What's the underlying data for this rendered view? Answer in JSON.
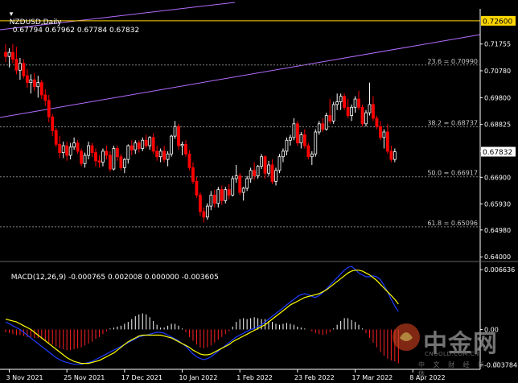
{
  "header": {
    "symbol": "NZDUSD,Daily",
    "ohlc": "0.67794 0.67962 0.67784 0.67832",
    "macd": "MACD(12,26,9) -0.000765 0.002008 0.000000 -0.003605"
  },
  "watermark": {
    "brand_cn": "中金网",
    "brand_en": "CNGOLD.COM.CN",
    "tagline": "中 文 财 经 新 媒 体"
  },
  "colors": {
    "background": "#000000",
    "axis": "#ffffff",
    "bull_candle": "#ffffff",
    "bear_candle": "#ff0000",
    "fib_lines": "#808080",
    "channel_line": "#b56cff",
    "resistance_line": "#ffd700",
    "macd_hist_pos": "#ffffff",
    "macd_hist_neg": "#ff2020",
    "macd_line": "#1e3cff",
    "signal_line": "#ffff00"
  },
  "chart_data": [
    {
      "type": "candlestick",
      "symbol": "NZDUSD",
      "timeframe": "Daily",
      "y_ticks": [
        0.71755,
        0.7078,
        0.698,
        0.68825,
        0.6785,
        0.669,
        0.6593,
        0.6498,
        0.64
      ],
      "y_tick_labels": [
        "0.71755",
        "0.70780",
        "0.69800",
        "0.68825",
        "0.67850",
        "0.66900",
        "0.65930",
        "0.64980",
        "0.64000"
      ],
      "ylim": [
        0.6389,
        0.7286
      ],
      "current_price": 0.67832,
      "current_price_label": "0.67832",
      "resistance": {
        "value": 0.726,
        "label": "0.72600"
      },
      "fib_levels": [
        {
          "label": "23.6 = 0.70990",
          "value": 0.7099
        },
        {
          "label": "38.2 = 0.68737",
          "value": 0.68737
        },
        {
          "label": "50.0 = 0.66917",
          "value": 0.66917
        },
        {
          "label": "61.8 = 0.65096",
          "value": 0.65096
        }
      ],
      "x_labels": [
        {
          "label": "3 Nov 2021",
          "index": 1
        },
        {
          "label": "25 Nov 2021",
          "index": 17
        },
        {
          "label": "17 Dec 2021",
          "index": 33
        },
        {
          "label": "10 Jan 2022",
          "index": 49
        },
        {
          "label": "1 Feb 2022",
          "index": 65
        },
        {
          "label": "23 Feb 2022",
          "index": 81
        },
        {
          "label": "17 Mar 2022",
          "index": 97
        },
        {
          "label": "8 Apr 2022",
          "index": 113
        }
      ],
      "ohlc": [
        [
          0.7145,
          0.7175,
          0.711,
          0.713
        ],
        [
          0.713,
          0.716,
          0.709,
          0.7145
        ],
        [
          0.7145,
          0.7175,
          0.7105,
          0.712
        ],
        [
          0.712,
          0.7165,
          0.7065,
          0.708
        ],
        [
          0.708,
          0.7125,
          0.7045,
          0.7105
        ],
        [
          0.7105,
          0.712,
          0.705,
          0.706
        ],
        [
          0.706,
          0.7085,
          0.7015,
          0.7035
        ],
        [
          0.7035,
          0.7065,
          0.6995,
          0.7045
        ],
        [
          0.7045,
          0.707,
          0.7005,
          0.702
        ],
        [
          0.702,
          0.706,
          0.698,
          0.7035
        ],
        [
          0.7035,
          0.7045,
          0.6975,
          0.699
        ],
        [
          0.699,
          0.701,
          0.695,
          0.697
        ],
        [
          0.697,
          0.699,
          0.689,
          0.691
        ],
        [
          0.691,
          0.692,
          0.684,
          0.686
        ],
        [
          0.686,
          0.687,
          0.68,
          0.681
        ],
        [
          0.681,
          0.684,
          0.676,
          0.678
        ],
        [
          0.678,
          0.682,
          0.676,
          0.6805
        ],
        [
          0.6805,
          0.682,
          0.675,
          0.677
        ],
        [
          0.677,
          0.6815,
          0.6755,
          0.68
        ],
        [
          0.68,
          0.6835,
          0.679,
          0.6815
        ],
        [
          0.6815,
          0.6825,
          0.6775,
          0.6785
        ],
        [
          0.6785,
          0.6795,
          0.673,
          0.674
        ],
        [
          0.674,
          0.678,
          0.6725,
          0.677
        ],
        [
          0.677,
          0.682,
          0.6755,
          0.6805
        ],
        [
          0.6805,
          0.6815,
          0.6765,
          0.678
        ],
        [
          0.678,
          0.6795,
          0.673,
          0.675
        ],
        [
          0.675,
          0.677,
          0.6725,
          0.6745
        ],
        [
          0.6745,
          0.6795,
          0.673,
          0.6785
        ],
        [
          0.6785,
          0.6805,
          0.6755,
          0.677
        ],
        [
          0.677,
          0.6785,
          0.671,
          0.672
        ],
        [
          0.672,
          0.6805,
          0.6715,
          0.6795
        ],
        [
          0.6795,
          0.6805,
          0.675,
          0.6765
        ],
        [
          0.6765,
          0.6775,
          0.6715,
          0.6725
        ],
        [
          0.6725,
          0.676,
          0.6705,
          0.6755
        ],
        [
          0.6755,
          0.681,
          0.674,
          0.6805
        ],
        [
          0.6805,
          0.6825,
          0.677,
          0.679
        ],
        [
          0.679,
          0.6825,
          0.6775,
          0.6815
        ],
        [
          0.6815,
          0.6825,
          0.678,
          0.6795
        ],
        [
          0.6795,
          0.6835,
          0.6785,
          0.6825
        ],
        [
          0.6825,
          0.6845,
          0.6795,
          0.6805
        ],
        [
          0.6805,
          0.684,
          0.679,
          0.6835
        ],
        [
          0.6835,
          0.685,
          0.6775,
          0.6785
        ],
        [
          0.6785,
          0.6805,
          0.675,
          0.6765
        ],
        [
          0.6765,
          0.6795,
          0.6745,
          0.6785
        ],
        [
          0.6785,
          0.6805,
          0.6745,
          0.6755
        ],
        [
          0.6755,
          0.6785,
          0.673,
          0.6775
        ],
        [
          0.6775,
          0.6845,
          0.6765,
          0.684
        ],
        [
          0.684,
          0.6895,
          0.683,
          0.6875
        ],
        [
          0.6875,
          0.6885,
          0.679,
          0.6805
        ],
        [
          0.6805,
          0.682,
          0.677,
          0.681
        ],
        [
          0.681,
          0.6825,
          0.6765,
          0.6775
        ],
        [
          0.6775,
          0.679,
          0.6715,
          0.6725
        ],
        [
          0.6725,
          0.6745,
          0.6665,
          0.6675
        ],
        [
          0.6675,
          0.669,
          0.6615,
          0.6625
        ],
        [
          0.6625,
          0.6635,
          0.655,
          0.6565
        ],
        [
          0.6565,
          0.658,
          0.6525,
          0.6545
        ],
        [
          0.6545,
          0.6595,
          0.6535,
          0.6585
        ],
        [
          0.6585,
          0.664,
          0.657,
          0.6625
        ],
        [
          0.6625,
          0.6645,
          0.658,
          0.6595
        ],
        [
          0.6595,
          0.6655,
          0.658,
          0.6645
        ],
        [
          0.6645,
          0.666,
          0.659,
          0.6605
        ],
        [
          0.6605,
          0.6655,
          0.6595,
          0.6645
        ],
        [
          0.6645,
          0.6665,
          0.661,
          0.6625
        ],
        [
          0.6625,
          0.6695,
          0.662,
          0.6685
        ],
        [
          0.6685,
          0.6735,
          0.667,
          0.6695
        ],
        [
          0.6695,
          0.6705,
          0.6625,
          0.6635
        ],
        [
          0.6635,
          0.6655,
          0.6605,
          0.665
        ],
        [
          0.665,
          0.6695,
          0.664,
          0.6685
        ],
        [
          0.6685,
          0.6725,
          0.667,
          0.6715
        ],
        [
          0.6715,
          0.6745,
          0.668,
          0.6695
        ],
        [
          0.6695,
          0.6735,
          0.6685,
          0.673
        ],
        [
          0.673,
          0.6775,
          0.672,
          0.6765
        ],
        [
          0.6765,
          0.677,
          0.6685,
          0.6705
        ],
        [
          0.6705,
          0.675,
          0.6695,
          0.6735
        ],
        [
          0.6735,
          0.6755,
          0.6665,
          0.6675
        ],
        [
          0.6675,
          0.6725,
          0.666,
          0.6715
        ],
        [
          0.6715,
          0.6775,
          0.6705,
          0.6765
        ],
        [
          0.6765,
          0.6795,
          0.6745,
          0.6785
        ],
        [
          0.6785,
          0.6835,
          0.677,
          0.6825
        ],
        [
          0.6825,
          0.6845,
          0.6805,
          0.6835
        ],
        [
          0.6835,
          0.6905,
          0.6825,
          0.6885
        ],
        [
          0.6885,
          0.6895,
          0.6805,
          0.6815
        ],
        [
          0.6815,
          0.6855,
          0.6795,
          0.6845
        ],
        [
          0.6845,
          0.6865,
          0.6795,
          0.6805
        ],
        [
          0.6805,
          0.6815,
          0.6755,
          0.6765
        ],
        [
          0.6765,
          0.6785,
          0.6735,
          0.6775
        ],
        [
          0.6775,
          0.6865,
          0.6765,
          0.6855
        ],
        [
          0.6855,
          0.6895,
          0.6845,
          0.6885
        ],
        [
          0.6885,
          0.6905,
          0.6855,
          0.6865
        ],
        [
          0.6865,
          0.6925,
          0.686,
          0.6915
        ],
        [
          0.6915,
          0.6975,
          0.6885,
          0.6895
        ],
        [
          0.6895,
          0.6965,
          0.6885,
          0.6955
        ],
        [
          0.6955,
          0.6995,
          0.6935,
          0.6965
        ],
        [
          0.6965,
          0.6995,
          0.6935,
          0.6985
        ],
        [
          0.6985,
          0.6995,
          0.6935,
          0.6945
        ],
        [
          0.6945,
          0.6975,
          0.6905,
          0.6915
        ],
        [
          0.6915,
          0.6955,
          0.6895,
          0.6945
        ],
        [
          0.6945,
          0.6985,
          0.6925,
          0.6975
        ],
        [
          0.6975,
          0.7005,
          0.6935,
          0.6945
        ],
        [
          0.6945,
          0.6955,
          0.6875,
          0.6885
        ],
        [
          0.6885,
          0.6935,
          0.6875,
          0.6925
        ],
        [
          0.6925,
          0.7035,
          0.6915,
          0.6955
        ],
        [
          0.6955,
          0.6985,
          0.6895,
          0.6905
        ],
        [
          0.6905,
          0.6915,
          0.6865,
          0.6875
        ],
        [
          0.6875,
          0.6895,
          0.6825,
          0.6835
        ],
        [
          0.6835,
          0.6865,
          0.6795,
          0.6855
        ],
        [
          0.6855,
          0.6885,
          0.6775,
          0.6785
        ],
        [
          0.6785,
          0.6805,
          0.6745,
          0.6755
        ],
        [
          0.6755,
          0.6795,
          0.6745,
          0.6783
        ]
      ]
    },
    {
      "type": "macd",
      "title": "MACD(12,26,9)",
      "values_text": "-0.000765 0.002008 0.000000 -0.003605",
      "y_ticks": [
        0.00636,
        0.0,
        -0.003784
      ],
      "y_tick_labels": [
        "0.006636",
        "0.00",
        "-0.003784"
      ],
      "ylim": [
        -0.00398,
        0.00705
      ],
      "histogram": [
        -0.0003,
        -0.0004,
        -0.0005,
        -0.0006,
        -0.0006,
        -0.0007,
        -0.0008,
        -0.0008,
        -0.0009,
        -0.0009,
        -0.001,
        -0.0012,
        -0.0014,
        -0.0016,
        -0.0018,
        -0.002,
        -0.0021,
        -0.0022,
        -0.0022,
        -0.0021,
        -0.002,
        -0.0019,
        -0.0017,
        -0.0015,
        -0.0013,
        -0.001,
        -0.0008,
        -0.0005,
        -0.0002,
        0.0001,
        0.0002,
        0.0003,
        0.0004,
        0.0006,
        0.0008,
        0.0011,
        0.0014,
        0.0016,
        0.0017,
        0.0016,
        0.0013,
        0.0009,
        0.0005,
        0.0002,
        0.0002,
        0.0004,
        0.0006,
        0.0006,
        0.0004,
        0.0001,
        -0.0003,
        -0.0008,
        -0.0012,
        -0.0016,
        -0.0019,
        -0.002,
        -0.0019,
        -0.0017,
        -0.0014,
        -0.0011,
        -0.0008,
        -0.0005,
        -0.0002,
        0.0003,
        0.0008,
        0.0011,
        0.0012,
        0.0011,
        0.0012,
        0.0013,
        0.0012,
        0.0011,
        0.0011,
        0.0009,
        0.0008,
        0.0006,
        0.0005,
        0.0006,
        0.0007,
        0.0006,
        0.0005,
        0.0003,
        0.0002,
        0.0001,
        0.0,
        -0.0002,
        -0.0004,
        -0.0005,
        -0.0006,
        -0.0005,
        -0.0003,
        0.0001,
        0.0005,
        0.0009,
        0.0012,
        0.0012,
        0.001,
        0.0008,
        0.0005,
        0.0001,
        -0.0004,
        -0.0009,
        -0.0014,
        -0.0019,
        -0.0024,
        -0.0028,
        -0.0031,
        -0.0033,
        -0.0034,
        -0.0036
      ],
      "macd_line": [
        0.0008,
        0.0006,
        0.0004,
        0.0002,
        0.0,
        -0.0003,
        -0.0006,
        -0.0009,
        -0.0012,
        -0.0015,
        -0.0018,
        -0.0021,
        -0.0024,
        -0.0027,
        -0.003,
        -0.0032,
        -0.0034,
        -0.0035,
        -0.0036,
        -0.0037,
        -0.0037,
        -0.0037,
        -0.0036,
        -0.0035,
        -0.0034,
        -0.0032,
        -0.003,
        -0.0028,
        -0.0026,
        -0.0024,
        -0.0022,
        -0.002,
        -0.0018,
        -0.0016,
        -0.0014,
        -0.0012,
        -0.001,
        -0.0008,
        -0.0007,
        -0.0006,
        -0.0005,
        -0.0004,
        -0.0003,
        -0.0003,
        -0.0004,
        -0.0006,
        -0.0008,
        -0.001,
        -0.0012,
        -0.0015,
        -0.0018,
        -0.0022,
        -0.0026,
        -0.0029,
        -0.0031,
        -0.0032,
        -0.0031,
        -0.0029,
        -0.0026,
        -0.0023,
        -0.002,
        -0.0017,
        -0.0014,
        -0.0011,
        -0.0008,
        -0.0006,
        -0.0004,
        -0.0002,
        0.0,
        0.0001,
        0.0003,
        0.0005,
        0.0008,
        0.0011,
        0.0014,
        0.0017,
        0.002,
        0.0023,
        0.0026,
        0.0029,
        0.0032,
        0.0035,
        0.0037,
        0.0038,
        0.0037,
        0.0035,
        0.0034,
        0.0036,
        0.0039,
        0.0043,
        0.0047,
        0.0051,
        0.0055,
        0.0059,
        0.0063,
        0.0066,
        0.0067,
        0.0064,
        0.006,
        0.0058,
        0.0056,
        0.0056,
        0.0057,
        0.0056,
        0.0053,
        0.0047,
        0.004,
        0.0032,
        0.0025,
        0.0019
      ],
      "signal_line": [
        0.0011,
        0.001,
        0.0009,
        0.0008,
        0.0006,
        0.0004,
        0.0002,
        0.0,
        -0.0003,
        -0.0006,
        -0.0009,
        -0.0012,
        -0.0015,
        -0.0018,
        -0.0021,
        -0.0024,
        -0.0027,
        -0.003,
        -0.0032,
        -0.0034,
        -0.0035,
        -0.0036,
        -0.0036,
        -0.0036,
        -0.0035,
        -0.0034,
        -0.0033,
        -0.0031,
        -0.0029,
        -0.0027,
        -0.0025,
        -0.0022,
        -0.0019,
        -0.0016,
        -0.0013,
        -0.0011,
        -0.0009,
        -0.0007,
        -0.0006,
        -0.0006,
        -0.0006,
        -0.0006,
        -0.0006,
        -0.0006,
        -0.0007,
        -0.0008,
        -0.0009,
        -0.0011,
        -0.0013,
        -0.0015,
        -0.0017,
        -0.0019,
        -0.0022,
        -0.0024,
        -0.0026,
        -0.0027,
        -0.0027,
        -0.0026,
        -0.0024,
        -0.0022,
        -0.002,
        -0.0018,
        -0.0016,
        -0.0013,
        -0.0011,
        -0.0009,
        -0.0007,
        -0.0005,
        -0.0003,
        -0.0001,
        0.0001,
        0.0003,
        0.0005,
        0.0008,
        0.0011,
        0.0014,
        0.0017,
        0.002,
        0.0023,
        0.0026,
        0.0028,
        0.003,
        0.0032,
        0.0034,
        0.0035,
        0.0036,
        0.0037,
        0.0038,
        0.004,
        0.0042,
        0.0045,
        0.0048,
        0.0051,
        0.0054,
        0.0057,
        0.006,
        0.0062,
        0.0063,
        0.0063,
        0.0062,
        0.006,
        0.0058,
        0.0055,
        0.0052,
        0.0048,
        0.0044,
        0.004,
        0.0036,
        0.0032,
        0.0027
      ]
    }
  ]
}
